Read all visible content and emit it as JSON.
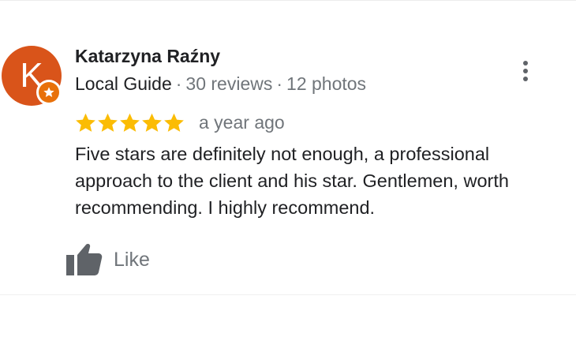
{
  "review": {
    "avatar_letter": "K",
    "author_name": "Katarzyna Raźny",
    "badge": "Local Guide",
    "reviews_count": "30 reviews",
    "photos_count": "12 photos",
    "separator": "·",
    "rating": 5,
    "rating_max": 5,
    "time_ago": "a year ago",
    "text": "Five stars are definitely not enough, a professional approach to the client and his star. Gentlemen, worth recommending. I highly recommend.",
    "like_label": "Like"
  },
  "colors": {
    "avatar": "#d9541a",
    "badge": "#e8710a",
    "star": "#fbbc04",
    "text_primary": "#202124",
    "text_secondary": "#70757a"
  },
  "icons": {
    "more": "more-vertical-icon",
    "like": "thumbs-up-icon",
    "badge": "local-guide-star-icon",
    "star": "star-icon"
  }
}
